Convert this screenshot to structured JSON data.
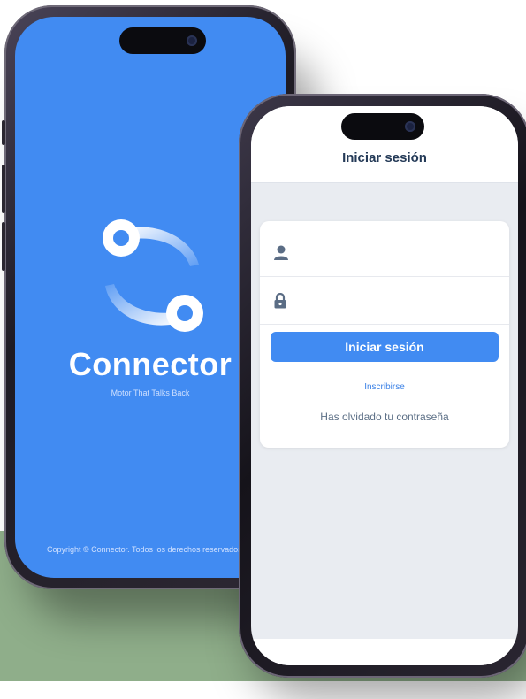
{
  "splash": {
    "brand": "Connector",
    "tagline": "Motor That Talks Back",
    "copyright": "Copyright © Connector. Todos los derechos reservados",
    "logo_icon": "connector-logo-icon",
    "background_color": "#418bf2"
  },
  "login": {
    "title": "Iniciar sesión",
    "username_icon": "user-icon",
    "username_value": "",
    "password_icon": "lock-icon",
    "password_value": "",
    "submit_label": "Iniciar sesión",
    "signup_link": "Inscribirse",
    "forgot_link": "Has olvidado tu contraseña",
    "accent_color": "#418bf2",
    "title_color": "#243a57"
  }
}
